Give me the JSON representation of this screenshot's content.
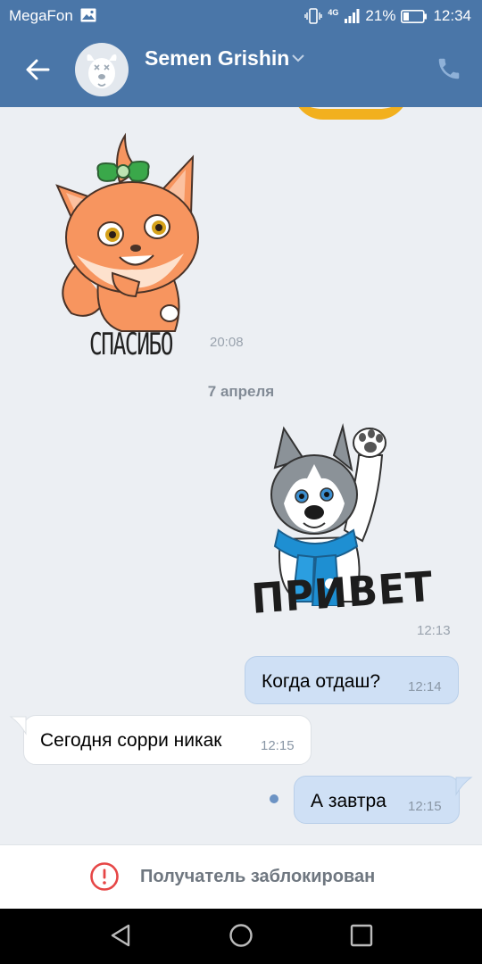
{
  "status_bar": {
    "carrier": "MegaFon",
    "network": "4G",
    "battery_percent": "21%",
    "time": "12:34"
  },
  "header": {
    "contact_name": "Semen Grishin",
    "icons": {
      "back": "arrow-left-icon",
      "dropdown": "chevron-down-icon",
      "call": "phone-icon",
      "avatar": "deactivated-dog-avatar"
    }
  },
  "messages": [
    {
      "type": "sticker",
      "direction": "in",
      "sticker_caption": "СПАСИБО",
      "time": "20:08"
    },
    {
      "type": "date",
      "label": "7 апреля"
    },
    {
      "type": "sticker",
      "direction": "out",
      "sticker_caption": "ПРИВЕТ",
      "time": "12:13"
    },
    {
      "type": "text",
      "direction": "out",
      "text": "Когда отдаш?",
      "time": "12:14"
    },
    {
      "type": "text",
      "direction": "in",
      "text": "Сегодня сорри никак",
      "time": "12:15"
    },
    {
      "type": "text",
      "direction": "out",
      "text": "А завтра",
      "time": "12:15",
      "unread": true
    }
  ],
  "blocked_bar": {
    "label": "Получатель заблокирован",
    "icon": "warning-circle-icon",
    "icon_color": "#e64646"
  },
  "colors": {
    "header": "#4a76a8",
    "chat_background": "#eceff3",
    "outgoing_bubble": "#cfe0f5",
    "incoming_bubble": "#ffffff"
  }
}
